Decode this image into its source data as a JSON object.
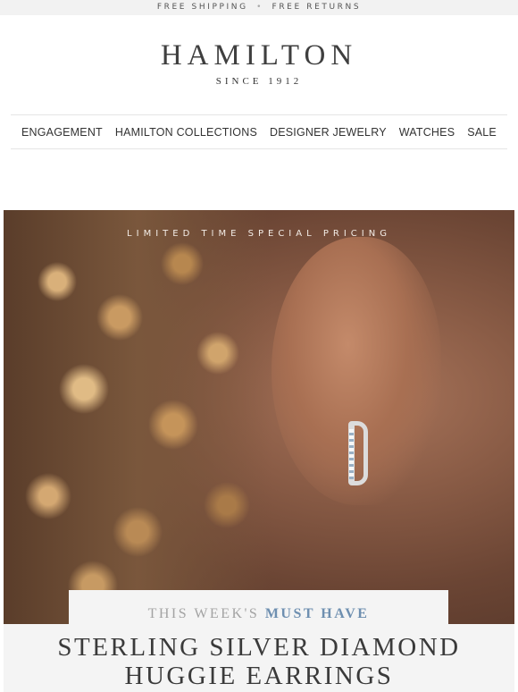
{
  "topbar": {
    "shipping": "FREE SHIPPING",
    "separator": "•",
    "returns": "FREE RETURNS"
  },
  "brand": {
    "name": "HAMILTON",
    "tagline": "SINCE 1912"
  },
  "nav": {
    "items": [
      {
        "label": "ENGAGEMENT"
      },
      {
        "label": "HAMILTON COLLECTIONS"
      },
      {
        "label": "DESIGNER JEWELRY"
      },
      {
        "label": "WATCHES"
      },
      {
        "label": "SALE"
      }
    ]
  },
  "hero": {
    "promo": "LIMITED TIME SPECIAL PRICING",
    "image_icon": "hero-photo-earring"
  },
  "feature": {
    "kicker_prefix": "THIS WEEK'S",
    "kicker_accent": "MUST HAVE",
    "title_line1": "STERLING SILVER DIAMOND",
    "title_line2": "HUGGIE EARRINGS"
  },
  "colors": {
    "accent": "#6e8fb0",
    "topbar_bg": "#f2f2f2",
    "card_bg": "#f4f4f4"
  }
}
